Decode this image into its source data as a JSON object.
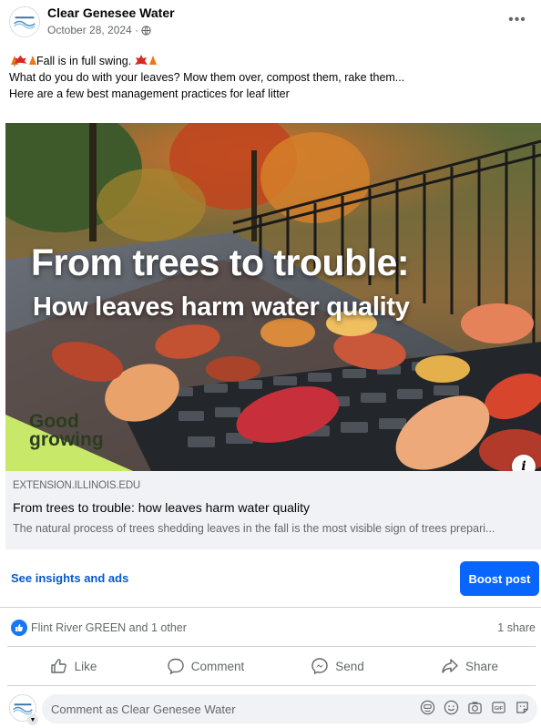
{
  "post": {
    "page_name": "Clear Genesee Water",
    "date": "October 28, 2024 ·",
    "avatar_text": "CLEAR GENESEE WATER",
    "more_label": "•••"
  },
  "text": {
    "line1": "Fall is in full swing.",
    "line2": "What do you do with your leaves? Mow them over, compost them, rake them...",
    "line3": "Here are a few best management practices for leaf litter"
  },
  "hero": {
    "title_line1": "From trees to trouble:",
    "title_line2": "How leaves harm water quality",
    "brand_line1": "Good",
    "brand_line2": "growing",
    "info_label": "i"
  },
  "card": {
    "domain": "EXTENSION.ILLINOIS.EDU",
    "title": "From trees to trouble: how leaves harm water quality",
    "description": "The natural process of trees shedding leaves in the fall is the most visible sign of trees prepari..."
  },
  "insights": {
    "link_label": "See insights and ads",
    "boost_label": "Boost post"
  },
  "reactions": {
    "text": "Flint River GREEN and 1 other",
    "shares": "1 share"
  },
  "actions": {
    "like": "Like",
    "comment": "Comment",
    "send": "Send",
    "share": "Share"
  },
  "comment": {
    "placeholder": "Comment as Clear Genesee Water"
  },
  "colors": {
    "accent": "#0866ff",
    "link": "#0a58ca",
    "secondary_text": "#65676b",
    "brand_green": "#c8e86a"
  }
}
